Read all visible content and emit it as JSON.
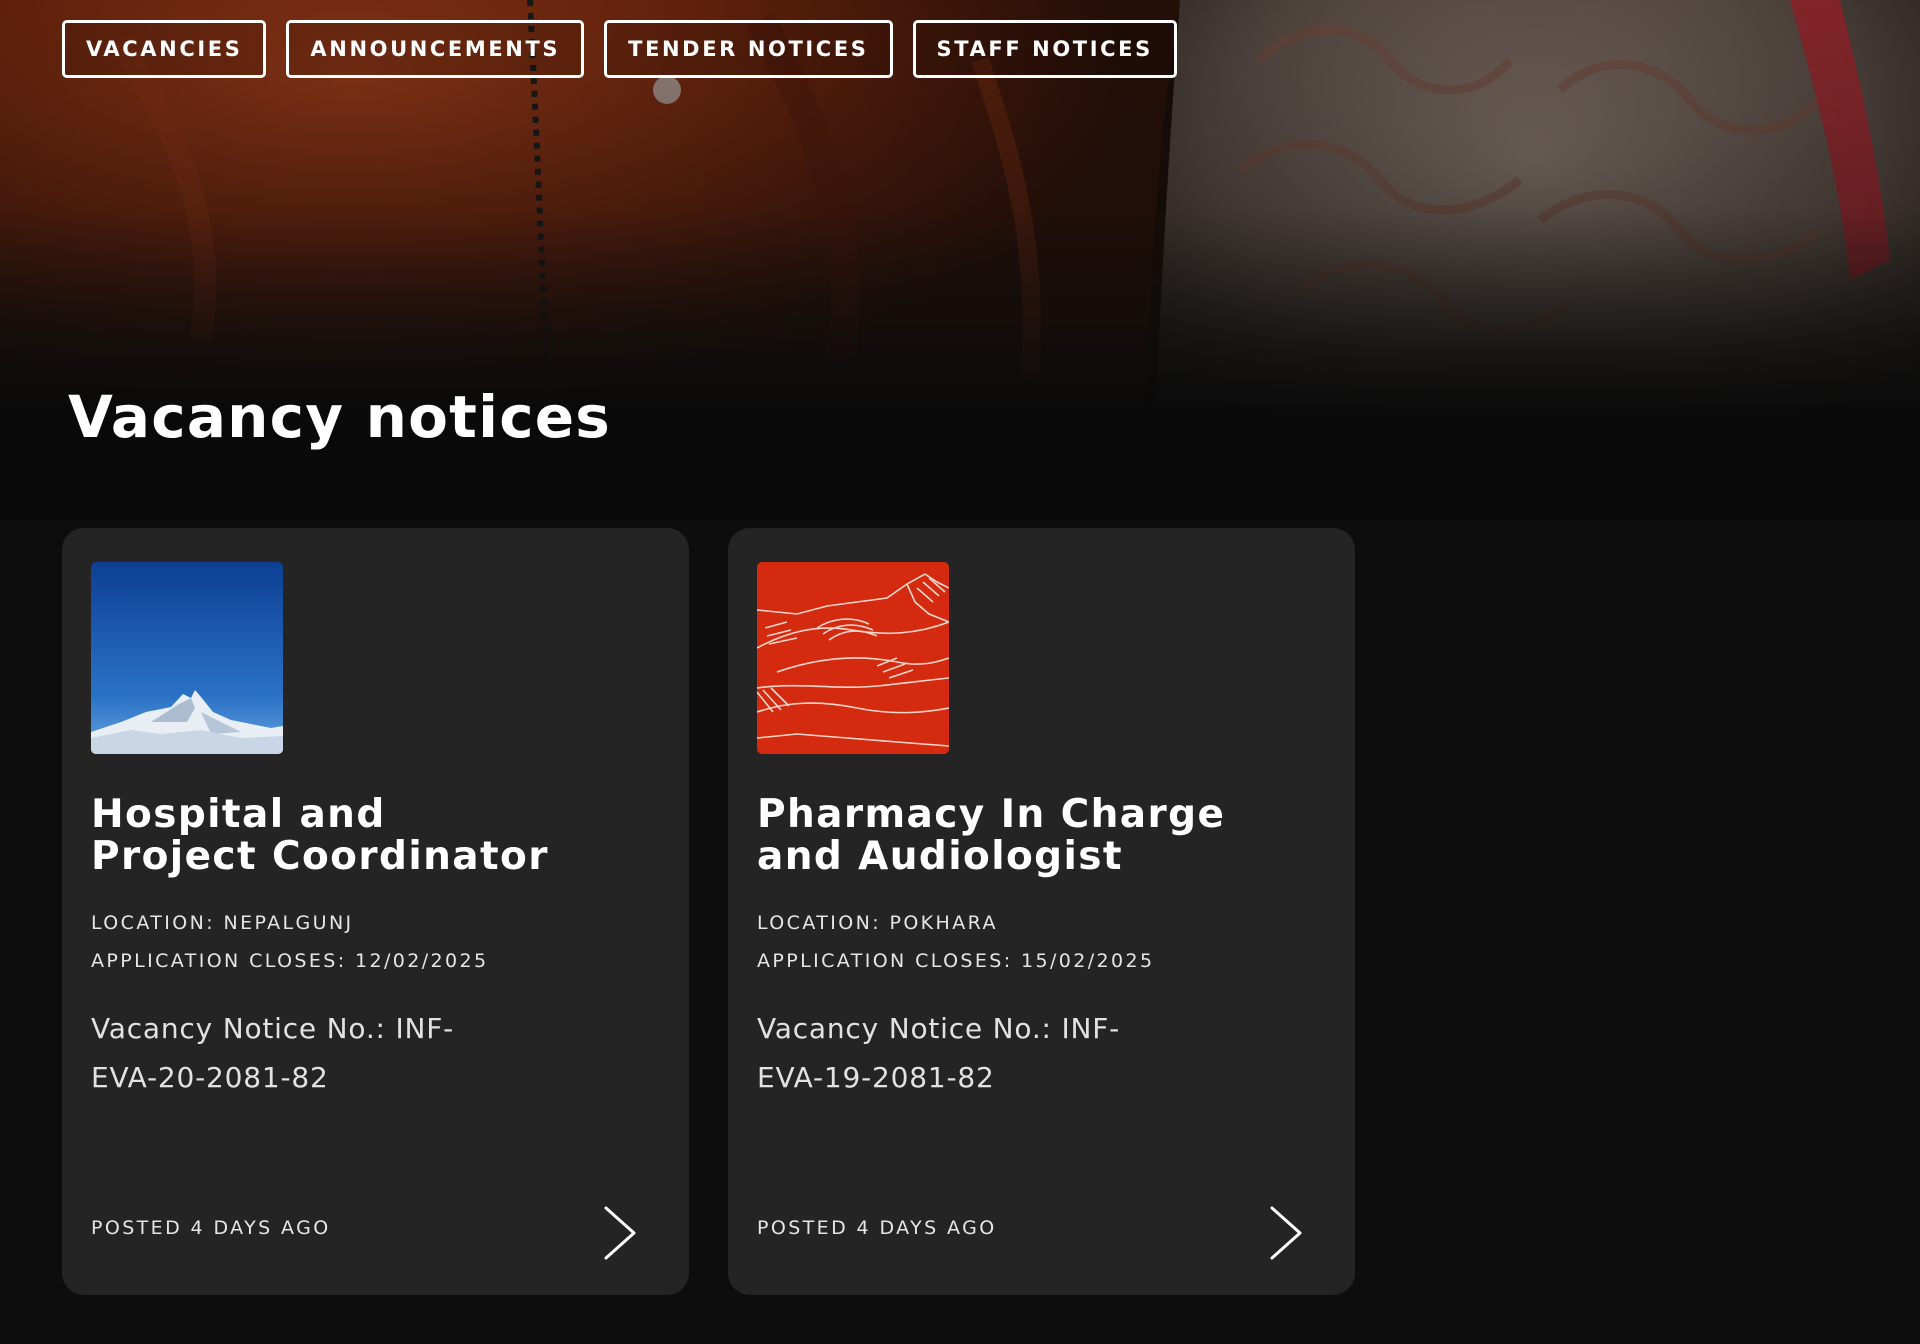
{
  "tabs": [
    {
      "label": "VACANCIES"
    },
    {
      "label": "ANNOUNCEMENTS"
    },
    {
      "label": "TENDER NOTICES"
    },
    {
      "label": "STAFF NOTICES"
    }
  ],
  "section": {
    "title": "Vacancy notices"
  },
  "cards": [
    {
      "image": "mountain-peak-photo",
      "title_line1": "Hospital and",
      "title_line2": "Project Coordinator",
      "location": "LOCATION: NEPALGUNJ",
      "closes": "APPLICATION CLOSES: 12/02/2025",
      "notice_line1": "Vacancy Notice No.: INF-",
      "notice_line2": "EVA-20-2081-82",
      "posted": "POSTED 4 DAYS AGO",
      "arrow_icon": "chevron-right-icon"
    },
    {
      "image": "red-mountain-line-art",
      "title_line1": "Pharmacy In Charge",
      "title_line2": "and Audiologist",
      "location": "LOCATION: POKHARA",
      "closes": "APPLICATION CLOSES: 15/02/2025",
      "notice_line1": "Vacancy Notice No.: INF-",
      "notice_line2": "EVA-19-2081-82",
      "posted": "POSTED 4 DAYS AGO",
      "arrow_icon": "chevron-right-icon"
    }
  ],
  "colors": {
    "page_background": "#0d0d0d",
    "card_background": "#242424",
    "text": "#ffffff",
    "hero_orange": "#7a2a10",
    "thumb_red": "#d42a10",
    "thumb_sky": "#1e5fb4"
  }
}
